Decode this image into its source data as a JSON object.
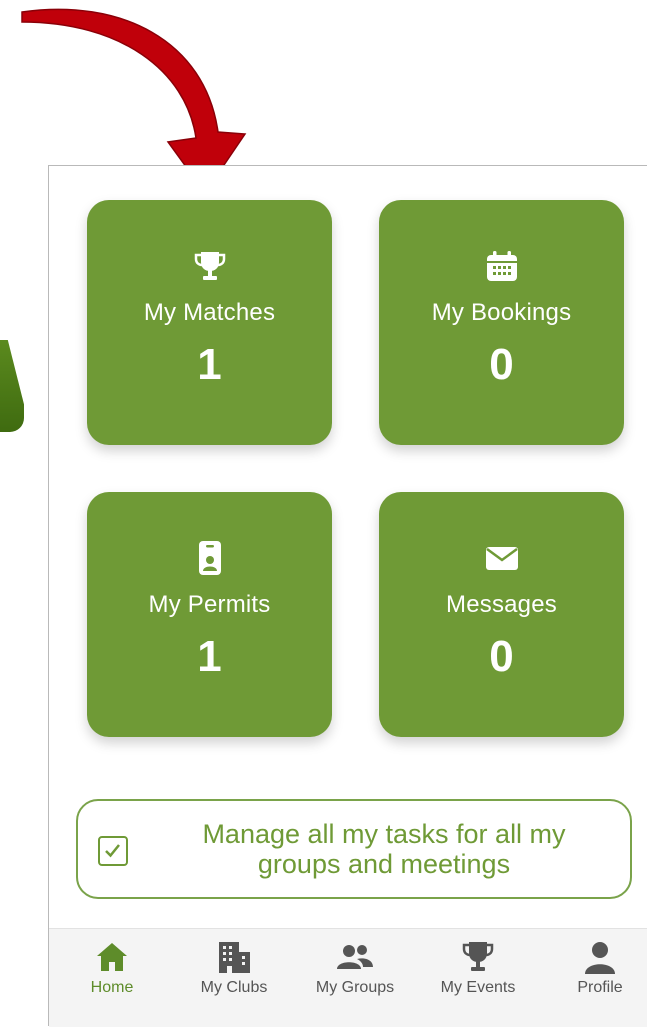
{
  "tiles": {
    "matches": {
      "label": "My Matches",
      "count": "1",
      "icon": "trophy-icon"
    },
    "bookings": {
      "label": "My Bookings",
      "count": "0",
      "icon": "calendar-icon"
    },
    "permits": {
      "label": "My Permits",
      "count": "1",
      "icon": "id-badge-icon"
    },
    "messages": {
      "label": "Messages",
      "count": "0",
      "icon": "envelope-icon"
    }
  },
  "task_banner": {
    "text": "Manage all my tasks for all my groups and meetings",
    "icon": "checkbox-icon"
  },
  "tabbar": {
    "items": [
      {
        "label": "Home",
        "icon": "home-icon",
        "active": true
      },
      {
        "label": "My Clubs",
        "icon": "building-icon",
        "active": false
      },
      {
        "label": "My Groups",
        "icon": "users-icon",
        "active": false
      },
      {
        "label": "My Events",
        "icon": "trophy-icon",
        "active": false
      },
      {
        "label": "Profile",
        "icon": "person-icon",
        "active": false
      }
    ]
  },
  "colors": {
    "tile_green": "#6f9a36",
    "accent_green": "#5e8c2a",
    "annotation_arrow": "#c0000a"
  }
}
